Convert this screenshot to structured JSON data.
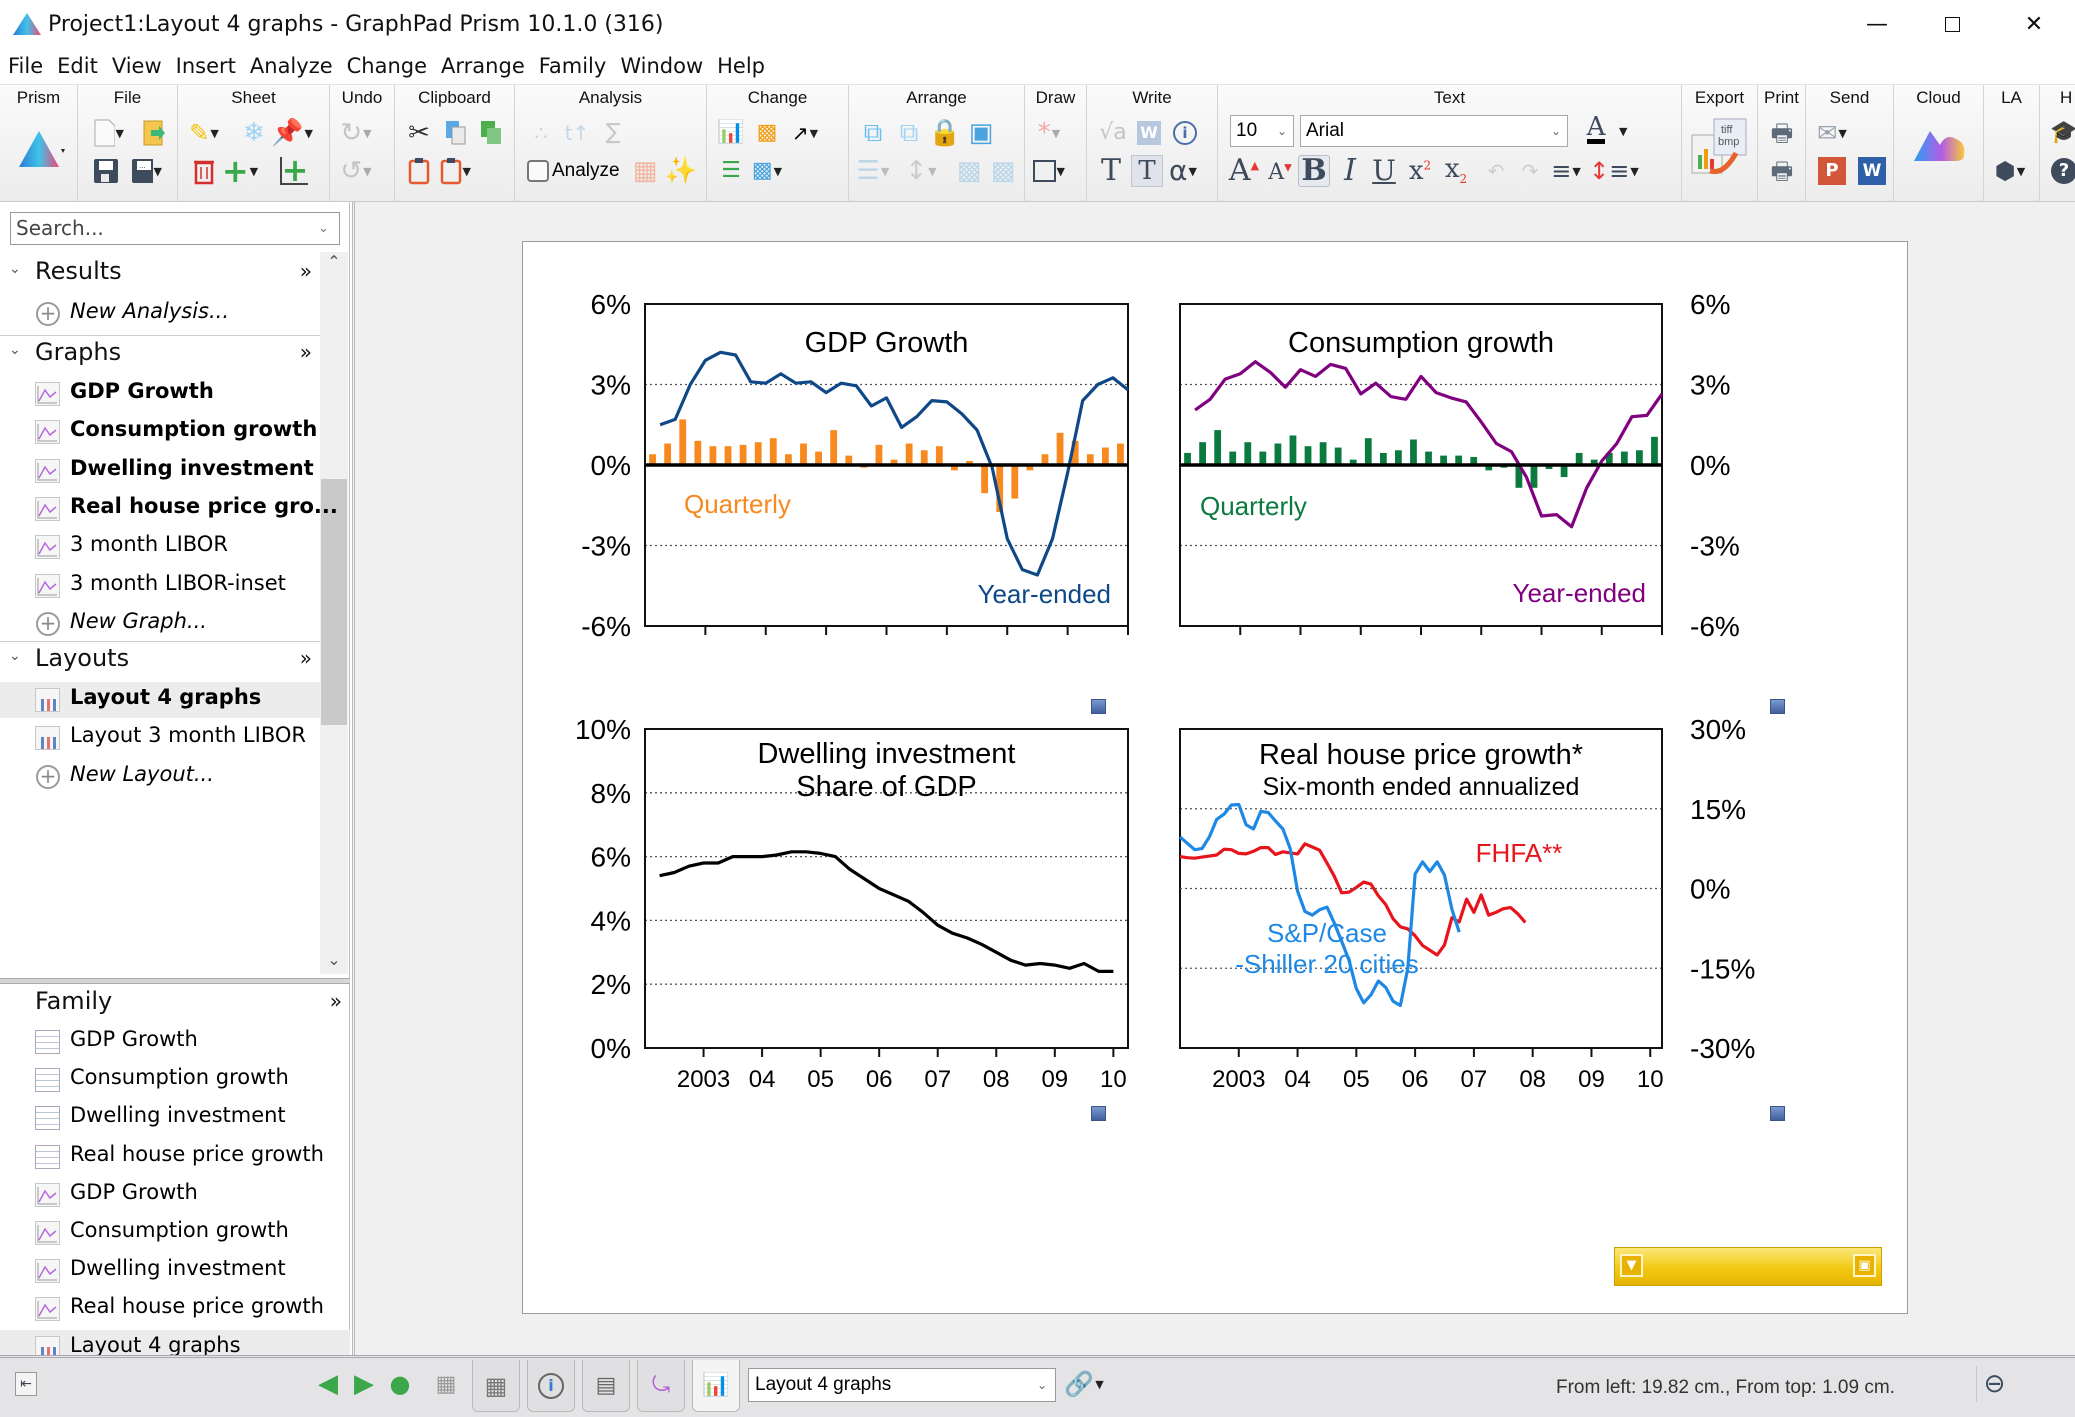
{
  "window": {
    "title": "Project1:Layout 4 graphs - GraphPad Prism 10.1.0 (316)",
    "controls": [
      "minimize",
      "maximize",
      "close"
    ]
  },
  "menu": [
    "File",
    "Edit",
    "View",
    "Insert",
    "Analyze",
    "Change",
    "Arrange",
    "Family",
    "Window",
    "Help"
  ],
  "ribbon": {
    "groups": [
      "Prism",
      "File",
      "Sheet",
      "Undo",
      "Clipboard",
      "Analysis",
      "Change",
      "Arrange",
      "Draw",
      "Write",
      "Text",
      "Export",
      "Print",
      "Send",
      "Cloud",
      "LA",
      "H"
    ],
    "analyze_label": "Analyze",
    "font_size": "10",
    "font_name": "Arial",
    "export_icon_text": [
      "tiff",
      "bmp"
    ],
    "send_ppt": "P",
    "send_word": "W",
    "text_color": "#000000"
  },
  "navigator": {
    "search_placeholder": "Search...",
    "sections": {
      "results": {
        "label": "Results",
        "items": [
          {
            "label": "New Analysis...",
            "type": "new"
          }
        ]
      },
      "graphs": {
        "label": "Graphs",
        "items": [
          {
            "label": "GDP Growth",
            "bold": true
          },
          {
            "label": "Consumption growth",
            "bold": true
          },
          {
            "label": "Dwelling investment",
            "bold": true
          },
          {
            "label": "Real house price gro...",
            "bold": true
          },
          {
            "label": "3 month LIBOR",
            "bold": false
          },
          {
            "label": "3 month LIBOR-inset",
            "bold": false
          },
          {
            "label": "New Graph...",
            "type": "new"
          }
        ]
      },
      "layouts": {
        "label": "Layouts",
        "items": [
          {
            "label": "Layout 4 graphs",
            "bold": true,
            "selected": true
          },
          {
            "label": "Layout 3 month LIBOR",
            "bold": false
          },
          {
            "label": "New Layout...",
            "type": "new"
          }
        ]
      }
    },
    "family": {
      "label": "Family",
      "items": [
        {
          "label": "GDP Growth",
          "icon": "data-table"
        },
        {
          "label": "Consumption growth",
          "icon": "data-table"
        },
        {
          "label": "Dwelling investment",
          "icon": "data-table"
        },
        {
          "label": "Real house price growth",
          "icon": "data-table"
        },
        {
          "label": "GDP Growth",
          "icon": "graph"
        },
        {
          "label": "Consumption growth",
          "icon": "graph"
        },
        {
          "label": "Dwelling investment",
          "icon": "graph"
        },
        {
          "label": "Real house price growth",
          "icon": "graph"
        },
        {
          "label": "Layout 4 graphs",
          "icon": "layout",
          "selected": true
        }
      ]
    }
  },
  "statusbar": {
    "current_sheet": "Layout 4 graphs",
    "position_readout": "From left: 19.82 cm., From top: 1.09 cm."
  },
  "chart_data": [
    {
      "id": "gdp",
      "type": "bar+line",
      "title": "GDP Growth",
      "ylim": [
        -6,
        6
      ],
      "yticks": [
        6,
        3,
        0,
        -3,
        -6
      ],
      "ytick_labels": [
        "6%",
        "3%",
        "0%",
        "-3%",
        "-6%"
      ],
      "yaxis_side": "left",
      "grid": "dotted at ±3%",
      "xlim": [
        2002.0,
        2010.0
      ],
      "xticks": [
        2003,
        2004,
        2005,
        2006,
        2007,
        2008,
        2009,
        2010
      ],
      "show_xtick_labels": false,
      "series": [
        {
          "name": "Quarterly",
          "kind": "bar",
          "color": "#F7891F",
          "x_start": 2002.25,
          "x_step": 0.25,
          "values": [
            0.4,
            0.8,
            1.7,
            0.9,
            0.7,
            0.7,
            0.75,
            0.85,
            1.0,
            0.4,
            0.8,
            0.5,
            1.3,
            0.35,
            -0.1,
            0.75,
            0.2,
            0.8,
            0.55,
            0.7,
            -0.2,
            0.15,
            -1.05,
            -1.75,
            -1.25,
            -0.2,
            0.4,
            1.2,
            0.9,
            0.4,
            0.65,
            0.8
          ]
        },
        {
          "name": "Year-ended",
          "kind": "line",
          "color": "#0F4886",
          "x_start": 2002.25,
          "x_step": 0.25,
          "values": [
            1.5,
            1.7,
            3.0,
            3.9,
            4.2,
            4.1,
            3.1,
            3.05,
            3.4,
            3.05,
            3.1,
            2.7,
            3.05,
            2.95,
            2.2,
            2.5,
            1.4,
            1.8,
            2.4,
            2.35,
            1.9,
            1.3,
            -0.1,
            -2.75,
            -3.9,
            -4.1,
            -2.75,
            -0.3,
            2.4,
            3.0,
            3.25,
            2.8
          ]
        }
      ],
      "annotations": [
        {
          "text": "Quarterly",
          "color": "#F7891F"
        },
        {
          "text": "Year-ended",
          "color": "#0F4886"
        }
      ]
    },
    {
      "id": "consumption",
      "type": "bar+line",
      "title": "Consumption growth",
      "ylim": [
        -6,
        6
      ],
      "yticks": [
        6,
        3,
        0,
        -3,
        -6
      ],
      "ytick_labels": [
        "6%",
        "3%",
        "0%",
        "-3%",
        "-6%"
      ],
      "yaxis_side": "right",
      "grid": "dotted at ±3%",
      "xlim": [
        2002.0,
        2010.0
      ],
      "xticks": [
        2003,
        2004,
        2005,
        2006,
        2007,
        2008,
        2009,
        2010
      ],
      "show_xtick_labels": false,
      "series": [
        {
          "name": "Quarterly",
          "kind": "bar",
          "color": "#0B7A3E",
          "x_start": 2002.25,
          "x_step": 0.25,
          "values": [
            0.45,
            0.85,
            1.3,
            0.5,
            0.85,
            0.5,
            0.8,
            1.1,
            0.7,
            0.85,
            0.65,
            0.2,
            1.0,
            0.45,
            0.55,
            0.95,
            0.5,
            0.35,
            0.35,
            0.3,
            -0.2,
            -0.1,
            -0.85,
            -0.85,
            -0.15,
            -0.45,
            0.45,
            0.2,
            0.45,
            0.5,
            0.55,
            1.05
          ]
        },
        {
          "name": "Year-ended",
          "kind": "line",
          "color": "#800080",
          "x_start": 2002.25,
          "x_step": 0.25,
          "values": [
            2.05,
            2.45,
            3.2,
            3.4,
            3.85,
            3.45,
            2.9,
            3.55,
            3.3,
            3.75,
            3.6,
            2.65,
            3.05,
            2.55,
            2.45,
            3.3,
            2.7,
            2.5,
            2.35,
            1.6,
            0.8,
            0.5,
            -0.45,
            -1.9,
            -1.85,
            -2.3,
            -0.85,
            0.15,
            0.8,
            1.8,
            1.85,
            2.65
          ]
        }
      ],
      "annotations": [
        {
          "text": "Quarterly",
          "color": "#0B7A3E"
        },
        {
          "text": "Year-ended",
          "color": "#800080"
        }
      ]
    },
    {
      "id": "dwelling",
      "type": "line",
      "title": "Dwelling investment",
      "subtitle": "Share of GDP",
      "ylim": [
        0,
        10
      ],
      "yticks": [
        10,
        8,
        6,
        4,
        2,
        0
      ],
      "ytick_labels": [
        "10%",
        "8%",
        "6%",
        "4%",
        "2%",
        "0%"
      ],
      "yaxis_side": "left",
      "grid": "dotted at 2,4,6,8",
      "xlim": [
        2002.0,
        2010.25
      ],
      "xticks": [
        2003,
        2004,
        2005,
        2006,
        2007,
        2008,
        2009,
        2010
      ],
      "xtick_labels": [
        "2003",
        "04",
        "05",
        "06",
        "07",
        "08",
        "09",
        "10"
      ],
      "series": [
        {
          "name": "Dwelling investment share of GDP",
          "kind": "line",
          "color": "#000000",
          "x_start": 2002.25,
          "x_step": 0.25,
          "values": [
            5.4,
            5.5,
            5.7,
            5.8,
            5.8,
            6.0,
            6.0,
            6.0,
            6.05,
            6.15,
            6.15,
            6.1,
            6.0,
            5.6,
            5.3,
            5.0,
            4.8,
            4.6,
            4.25,
            3.85,
            3.6,
            3.45,
            3.25,
            3.0,
            2.75,
            2.6,
            2.65,
            2.6,
            2.5,
            2.65,
            2.4,
            2.4
          ]
        }
      ]
    },
    {
      "id": "house",
      "type": "line",
      "title": "Real house price growth*",
      "subtitle": "Six-month ended annualized",
      "ylim": [
        -30,
        30
      ],
      "yticks": [
        30,
        15,
        0,
        -15,
        -30
      ],
      "ytick_labels": [
        "30%",
        "15%",
        "0%",
        "-15%",
        "-30%"
      ],
      "yaxis_side": "right",
      "grid": "dotted at 15, 0, -15",
      "xlim": [
        2002.0,
        2010.2
      ],
      "xticks": [
        2003,
        2004,
        2005,
        2006,
        2007,
        2008,
        2009,
        2010
      ],
      "xtick_labels": [
        "2003",
        "04",
        "05",
        "06",
        "07",
        "08",
        "09",
        "10"
      ],
      "series": [
        {
          "name": "FHFA**",
          "kind": "line",
          "color": "#E8141C",
          "x_start": 2002.0,
          "x_step": 0.125,
          "values": [
            6.0,
            5.8,
            5.7,
            5.9,
            6.1,
            6.3,
            7.4,
            7.3,
            6.6,
            6.5,
            7.0,
            7.7,
            7.7,
            6.4,
            6.9,
            6.7,
            6.5,
            8.4,
            7.8,
            7.2,
            4.8,
            2.3,
            -0.8,
            -0.7,
            0.2,
            1.2,
            0.8,
            -1.4,
            -3.0,
            -5.7,
            -7.2,
            -7.6,
            -8.9,
            -10.7,
            -11.6,
            -12.5,
            -10.6,
            -5.5,
            -6.3,
            -2.0,
            -4.5,
            -1.2,
            -5.0,
            -4.5,
            -3.8,
            -3.6,
            -4.8,
            -6.4
          ]
        },
        {
          "name": "S&P/Case-Shiller 20 cities",
          "kind": "line",
          "color": "#1E88E5",
          "x_start": 2002.0,
          "x_step": 0.125,
          "values": [
            9.7,
            8.5,
            7.3,
            7.5,
            9.7,
            13.0,
            14.0,
            15.7,
            15.8,
            12.0,
            11.2,
            14.5,
            14.3,
            12.7,
            11.2,
            7.5,
            -0.5,
            -4.3,
            -5.0,
            -4.0,
            -3.5,
            -6.5,
            -9.9,
            -13.5,
            -18.8,
            -21.5,
            -20.0,
            -17.4,
            -18.6,
            -21.2,
            -22.0,
            -15.0,
            2.7,
            5.0,
            3.2,
            5.0,
            2.5,
            -3.9,
            -8.2
          ]
        }
      ],
      "annotations": [
        {
          "text": "FHFA**",
          "color": "#E8141C"
        },
        {
          "text": "S&P/Case",
          "color": "#1E88E5"
        },
        {
          "text": "-Shiller 20 cities",
          "color": "#1E88E5"
        }
      ]
    }
  ]
}
